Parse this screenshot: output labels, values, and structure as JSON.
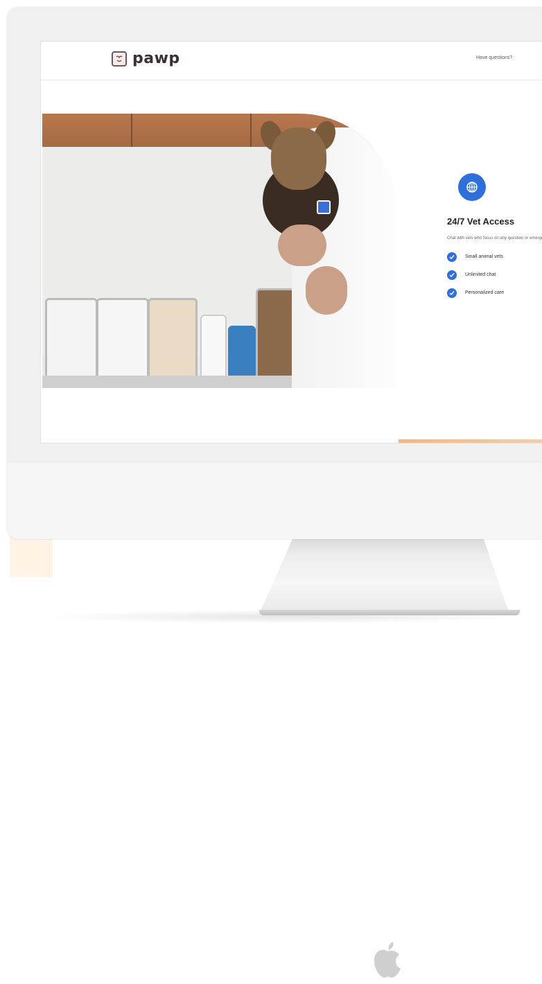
{
  "site": {
    "logo_text": "pawp",
    "header_link": "Have questions?"
  },
  "feature": {
    "title": "24/7 Vet Access",
    "description": "Chat with vets who focus on any question or emergency",
    "items": [
      {
        "label": "Small animal vets"
      },
      {
        "label": "Unlimited chat"
      },
      {
        "label": "Personalized care"
      }
    ]
  },
  "colors": {
    "accent_blue": "#2f6fdc",
    "logo_text": "#3b2f33",
    "monitor_frame": "#f0f0f0",
    "accent_peach": "#fff3e6"
  },
  "icons": {
    "feature": "globe-icon",
    "check": "check-circle-icon",
    "logo": "pawp-logo-icon",
    "brand": "apple-logo"
  }
}
